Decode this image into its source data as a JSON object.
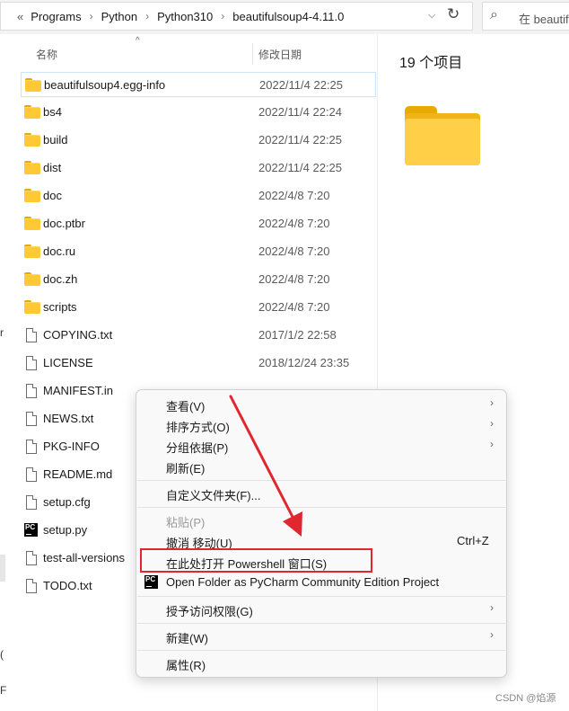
{
  "address_bar": {
    "overflow": "«",
    "crumbs": [
      "Programs",
      "Python",
      "Python310",
      "beautifulsoup4-4.11.0"
    ],
    "separator": "›",
    "dropdown_icon": "chevron-down-icon",
    "refresh_icon": "refresh-icon"
  },
  "search": {
    "placeholder": "在 beautif",
    "icon": "search-icon"
  },
  "left_nav": {
    "chars": [
      "r",
      "(",
      "F"
    ]
  },
  "columns": {
    "name": "名称",
    "date": "修改日期",
    "sort_indicator": "^"
  },
  "files": [
    {
      "name": "beautifulsoup4.egg-info",
      "date": "2022/11/4 22:25",
      "type": "folder",
      "selected": true
    },
    {
      "name": "bs4",
      "date": "2022/11/4 22:24",
      "type": "folder"
    },
    {
      "name": "build",
      "date": "2022/11/4 22:25",
      "type": "folder"
    },
    {
      "name": "dist",
      "date": "2022/11/4 22:25",
      "type": "folder"
    },
    {
      "name": "doc",
      "date": "2022/4/8 7:20",
      "type": "folder"
    },
    {
      "name": "doc.ptbr",
      "date": "2022/4/8 7:20",
      "type": "folder"
    },
    {
      "name": "doc.ru",
      "date": "2022/4/8 7:20",
      "type": "folder"
    },
    {
      "name": "doc.zh",
      "date": "2022/4/8 7:20",
      "type": "folder"
    },
    {
      "name": "scripts",
      "date": "2022/4/8 7:20",
      "type": "folder"
    },
    {
      "name": "COPYING.txt",
      "date": "2017/1/2 22:58",
      "type": "file"
    },
    {
      "name": "LICENSE",
      "date": "2018/12/24 23:35",
      "type": "file"
    },
    {
      "name": "MANIFEST.in",
      "date": "",
      "type": "file"
    },
    {
      "name": "NEWS.txt",
      "date": "",
      "type": "file"
    },
    {
      "name": "PKG-INFO",
      "date": "",
      "type": "file"
    },
    {
      "name": "README.md",
      "date": "",
      "type": "file"
    },
    {
      "name": "setup.cfg",
      "date": "",
      "type": "file"
    },
    {
      "name": "setup.py",
      "date": "",
      "type": "python"
    },
    {
      "name": "test-all-versions",
      "date": "",
      "type": "file"
    },
    {
      "name": "TODO.txt",
      "date": "",
      "type": "file"
    }
  ],
  "details": {
    "item_count": "19 个项目"
  },
  "context_menu": {
    "items": [
      {
        "label": "查看(V)",
        "submenu": true
      },
      {
        "label": "排序方式(O)",
        "submenu": true
      },
      {
        "label": "分组依据(P)",
        "submenu": true
      },
      {
        "label": "刷新(E)"
      },
      {
        "label": "自定义文件夹(F)..."
      },
      {
        "label": "粘贴(P)",
        "disabled": true
      },
      {
        "label": "撤消 移动(U)",
        "shortcut": "Ctrl+Z"
      },
      {
        "label": "在此处打开 Powershell 窗口(S)",
        "highlighted": true
      },
      {
        "label": "Open Folder as PyCharm Community Edition Project",
        "icon": "pycharm-icon"
      },
      {
        "label": "授予访问权限(G)",
        "submenu": true
      },
      {
        "label": "新建(W)",
        "submenu": true
      },
      {
        "label": "属性(R)"
      }
    ],
    "submenu_arrow": "›"
  },
  "annotation": {
    "color": "#e0262e"
  },
  "watermark": "CSDN @焰源"
}
